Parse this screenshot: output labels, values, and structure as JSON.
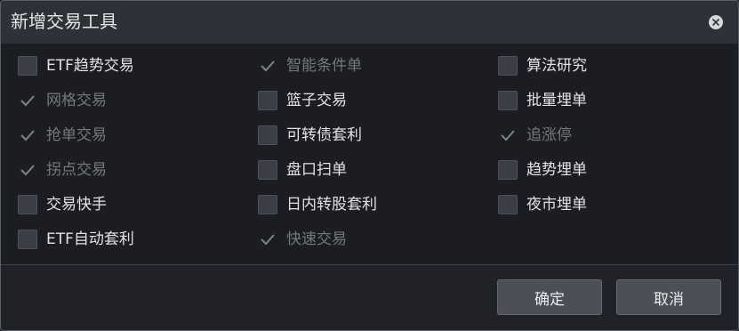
{
  "dialog": {
    "title": "新增交易工具",
    "close_icon": "close-icon"
  },
  "options": {
    "col1": [
      {
        "label": "ETF趋势交易",
        "checked": false
      },
      {
        "label": "网格交易",
        "checked": true
      },
      {
        "label": "抢单交易",
        "checked": true
      },
      {
        "label": "拐点交易",
        "checked": true
      },
      {
        "label": "交易快手",
        "checked": false
      },
      {
        "label": "ETF自动套利",
        "checked": false
      }
    ],
    "col2": [
      {
        "label": "智能条件单",
        "checked": true
      },
      {
        "label": "篮子交易",
        "checked": false
      },
      {
        "label": "可转债套利",
        "checked": false
      },
      {
        "label": "盘口扫单",
        "checked": false
      },
      {
        "label": "日内转股套利",
        "checked": false
      },
      {
        "label": "快速交易",
        "checked": true
      }
    ],
    "col3": [
      {
        "label": "算法研究",
        "checked": false
      },
      {
        "label": "批量埋单",
        "checked": false
      },
      {
        "label": "追涨停",
        "checked": true
      },
      {
        "label": "趋势埋单",
        "checked": false
      },
      {
        "label": "夜市埋单",
        "checked": false
      }
    ]
  },
  "footer": {
    "ok_label": "确定",
    "cancel_label": "取消"
  },
  "colors": {
    "checked_text": "#74777c",
    "unchecked_text": "#e3e3e3",
    "checkmark": "#7f8287",
    "checkbox_fill": "#3b3e45"
  }
}
